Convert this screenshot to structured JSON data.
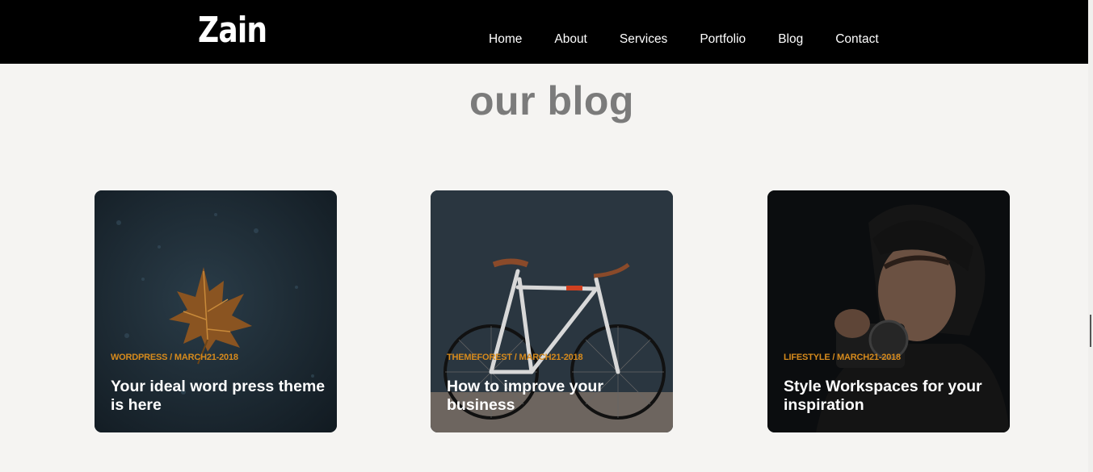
{
  "header": {
    "logo": "Zain",
    "nav": [
      "Home",
      "About",
      "Services",
      "Portfolio",
      "Blog",
      "Contact"
    ]
  },
  "blog": {
    "title": "our blog",
    "posts": [
      {
        "meta": "WORDPRESS / MARCH21-2018",
        "title": "Your ideal word press theme is here",
        "image": "maple-leaf-on-asphalt"
      },
      {
        "meta": "THEMEFOREST / MARCH21-2018",
        "title": "How to improve your business",
        "image": "white-bicycle-against-dark-wall"
      },
      {
        "meta": "LIFESTYLE / MARCH21-2018",
        "title": "Style Workspaces for your inspiration",
        "image": "man-holding-camera"
      }
    ]
  },
  "colors": {
    "accent": "#d68a1c",
    "nav_bg": "#000000",
    "page_bg": "#f5f4f2",
    "title_gray": "#7b7b7b"
  }
}
